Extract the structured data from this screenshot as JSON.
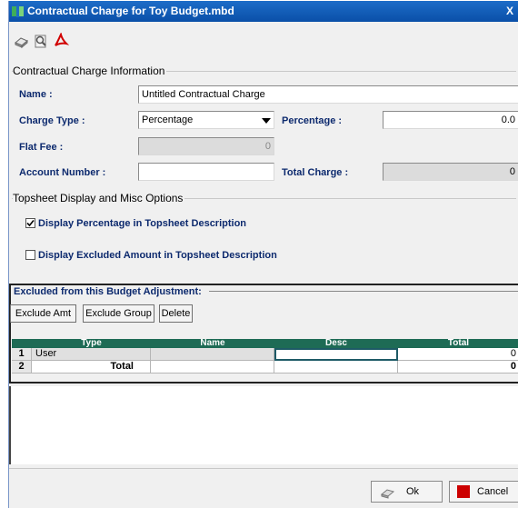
{
  "window": {
    "title": "Contractual Charge for Toy Budget.mbd",
    "close_symbol": "X"
  },
  "toolbar": {
    "icons": [
      "print-icon",
      "preview-icon",
      "pdf-icon"
    ]
  },
  "info": {
    "legend": "Contractual Charge Information",
    "name_label": "Name :",
    "name_value": "Untitled Contractual Charge",
    "charge_type_label": "Charge Type :",
    "charge_type_value": "Percentage",
    "percentage_label": "Percentage :",
    "percentage_value": "0.0",
    "flat_fee_label": "Flat Fee :",
    "flat_fee_value": "0",
    "account_label": "Account Number :",
    "account_value": "",
    "total_charge_label": "Total Charge :",
    "total_charge_value": "0"
  },
  "options": {
    "legend": "Topsheet Display and Misc Options",
    "display_percentage_label": "Display Percentage in Topsheet Description",
    "display_percentage_checked": true,
    "display_excluded_label": "Display Excluded Amount in Topsheet Description",
    "display_excluded_checked": false
  },
  "excluded": {
    "title": "Excluded from this Budget Adjustment:",
    "buttons": {
      "exclude_amt": "Exclude Amt",
      "exclude_group": "Exclude Group",
      "delete": "Delete"
    },
    "columns": [
      "Type",
      "Name",
      "Desc",
      "Total"
    ],
    "rows": [
      {
        "num": "1",
        "type": "User",
        "name": "",
        "desc": "",
        "total": "0"
      },
      {
        "num": "2",
        "type": "Total",
        "name": "",
        "desc": "",
        "total": "0"
      }
    ]
  },
  "footer": {
    "ok_label": "Ok",
    "cancel_label": "Cancel"
  }
}
